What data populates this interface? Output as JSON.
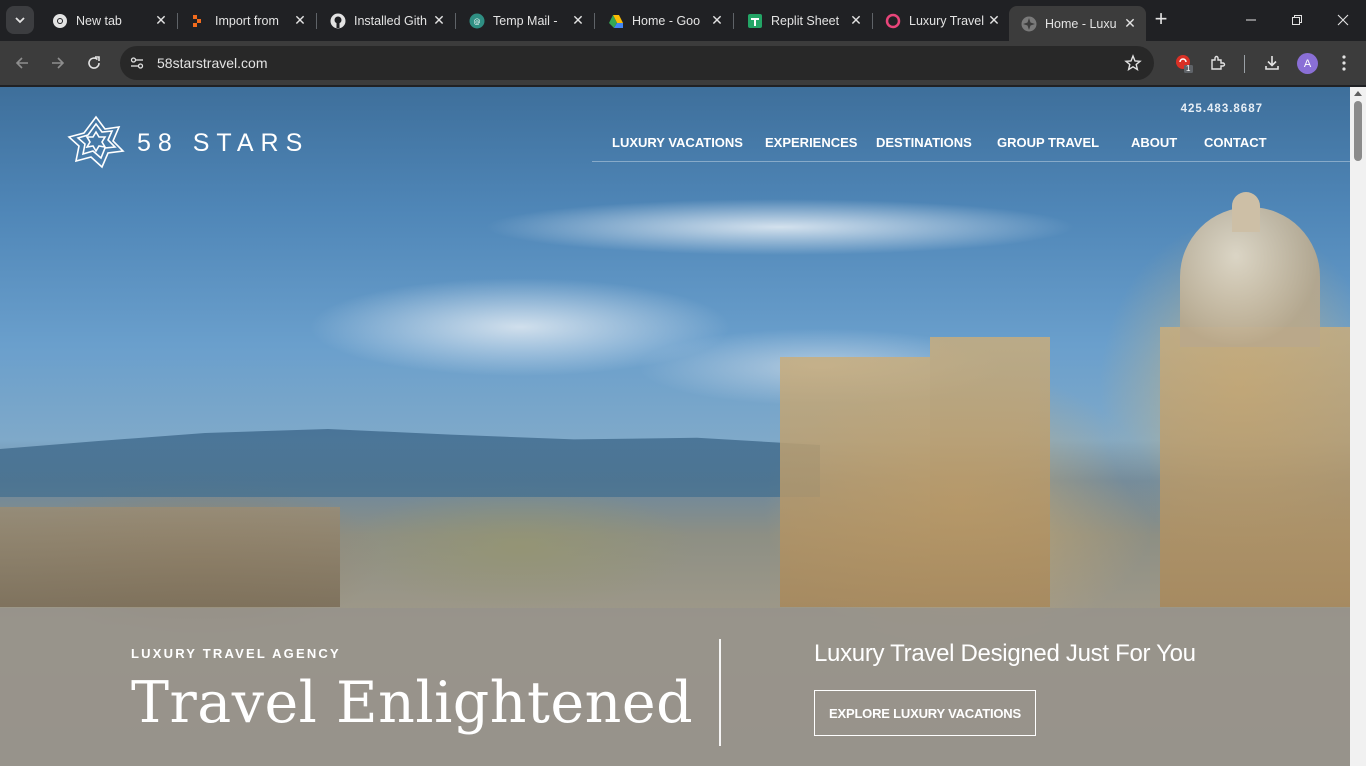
{
  "browser": {
    "tabs": [
      {
        "title": "New tab",
        "icon": "chrome-icon"
      },
      {
        "title": "Import from",
        "icon": "import-icon"
      },
      {
        "title": "Installed Gith",
        "icon": "github-icon"
      },
      {
        "title": "Temp Mail -",
        "icon": "tempmail-icon"
      },
      {
        "title": "Home - Goo",
        "icon": "google-drive-icon"
      },
      {
        "title": "Replit Sheet",
        "icon": "sheets-icon"
      },
      {
        "title": "Luxury Travel",
        "icon": "circle-icon"
      },
      {
        "title": "Home - Luxu",
        "icon": "58stars-icon"
      }
    ],
    "active_tab_index": 7,
    "url": "58starstravel.com",
    "extension_badge": "1",
    "profile_initial": "A"
  },
  "site": {
    "brand": "58 STARS",
    "phone": "425.483.8687",
    "nav": [
      "LUXURY VACATIONS",
      "EXPERIENCES",
      "DESTINATIONS",
      "GROUP TRAVEL",
      "ABOUT",
      "CONTACT"
    ],
    "eyebrow": "LUXURY TRAVEL AGENCY",
    "headline": "Travel Enlightened",
    "tagline": "Luxury Travel Designed Just For You",
    "cta": "EXPLORE LUXURY VACATIONS"
  },
  "colors": {
    "chrome_dark": "#202124",
    "toolbar": "#3c3c3c",
    "sky": "#4f86b7",
    "band": "#96928c"
  }
}
